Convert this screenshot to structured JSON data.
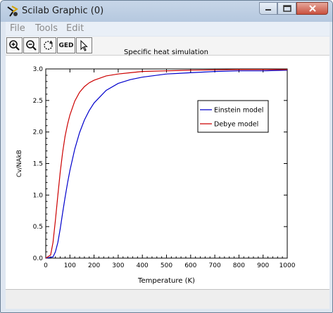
{
  "window": {
    "title": "Scilab Graphic (0)",
    "icons": [
      "scilab-app-icon",
      "minimize-icon",
      "maximize-icon",
      "close-icon"
    ]
  },
  "menu": {
    "items": [
      "File",
      "Tools",
      "Edit"
    ]
  },
  "toolbar": {
    "buttons": [
      {
        "name": "zoom-in",
        "icon": "zoom-in-icon"
      },
      {
        "name": "zoom-out",
        "icon": "zoom-out-icon"
      },
      {
        "name": "rotate",
        "icon": "rotate-icon"
      },
      {
        "name": "ged",
        "label": "GED"
      },
      {
        "name": "select",
        "icon": "pointer-icon"
      }
    ]
  },
  "chart_data": {
    "type": "line",
    "title": "Specific heat simulation",
    "xlabel": "Temperature (K)",
    "ylabel": "Cv/NAkB",
    "xlim": [
      0,
      1000
    ],
    "ylim": [
      0,
      3.0
    ],
    "x_ticks": [
      "0",
      "100",
      "200",
      "300",
      "400",
      "500",
      "600",
      "700",
      "800",
      "900",
      "1000"
    ],
    "y_ticks": [
      "0.0",
      "0.5",
      "1.0",
      "1.5",
      "2.0",
      "2.5",
      "3.0"
    ],
    "legend_position": "top-right",
    "series": [
      {
        "name": "Einstein model",
        "color": "#0000cc",
        "x": [
          0,
          30,
          40,
          50,
          60,
          70,
          80,
          90,
          100,
          120,
          140,
          160,
          180,
          200,
          250,
          300,
          350,
          400,
          500,
          600,
          700,
          800,
          900,
          1000
        ],
        "y": [
          0.0,
          0.02,
          0.1,
          0.25,
          0.47,
          0.72,
          0.96,
          1.19,
          1.39,
          1.73,
          1.99,
          2.19,
          2.34,
          2.46,
          2.66,
          2.77,
          2.83,
          2.87,
          2.92,
          2.94,
          2.96,
          2.97,
          2.97,
          2.98
        ]
      },
      {
        "name": "Debye model",
        "color": "#cc0000",
        "x": [
          0,
          20,
          30,
          40,
          50,
          60,
          70,
          80,
          90,
          100,
          120,
          140,
          160,
          180,
          200,
          250,
          300,
          350,
          400,
          500,
          600,
          700,
          800,
          900,
          1000
        ],
        "y": [
          0.0,
          0.05,
          0.25,
          0.6,
          1.0,
          1.37,
          1.68,
          1.93,
          2.12,
          2.27,
          2.49,
          2.63,
          2.72,
          2.78,
          2.82,
          2.89,
          2.92,
          2.94,
          2.96,
          2.97,
          2.98,
          2.985,
          2.99,
          2.99,
          2.99
        ]
      }
    ]
  }
}
